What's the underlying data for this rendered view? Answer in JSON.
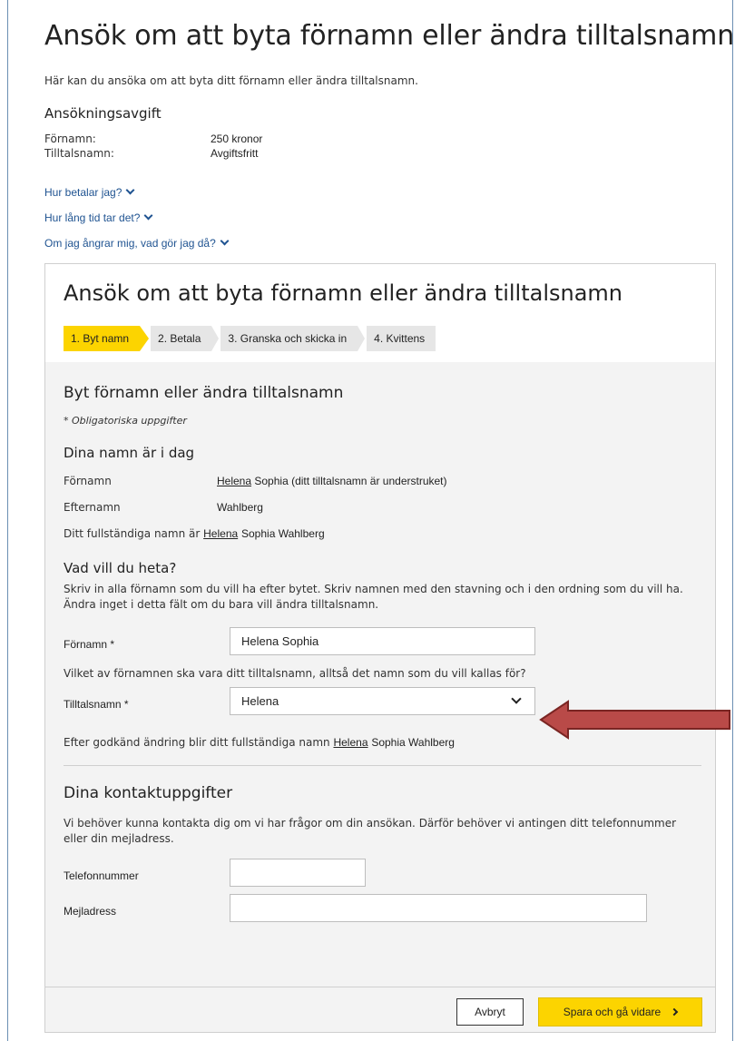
{
  "page": {
    "title": "Ansök om att byta förnamn eller ändra tilltalsnamn",
    "intro": "Här kan du ansöka om att byta ditt förnamn eller ändra tilltalsnamn.",
    "fee_heading": "Ansökningsavgift",
    "fees": [
      {
        "label": "Förnamn:",
        "value": "250 kronor"
      },
      {
        "label": "Tilltalsnamn:",
        "value": "Avgiftsfritt"
      }
    ],
    "accordions": [
      "Hur betalar jag?",
      "Hur lång tid tar det?",
      "Om jag ångrar mig, vad gör jag då?"
    ]
  },
  "form": {
    "title": "Ansök om att byta förnamn eller ändra tilltalsnamn",
    "steps": [
      "1. Byt namn",
      "2. Betala",
      "3. Granska och skicka in",
      "4. Kvittens"
    ],
    "section_title": "Byt förnamn eller ändra tilltalsnamn",
    "required_note": "* Obligatoriska uppgifter",
    "current": {
      "heading": "Dina namn är i dag",
      "first_label": "Förnamn",
      "first_call": "Helena",
      "first_rest": "Sophia",
      "first_note": "(ditt tilltalsnamn är understruket)",
      "last_label": "Efternamn",
      "last_value": "Wahlberg",
      "full_prefix": "Ditt fullständiga namn är",
      "full_call": "Helena",
      "full_rest": "Sophia Wahlberg"
    },
    "wanted": {
      "heading": "Vad vill du heta?",
      "instructions": "Skriv in alla förnamn som du vill ha efter bytet. Skriv namnen med den stavning och i den ordning som du vill ha. Ändra inget i detta fält om du bara vill ändra tilltalsnamn.",
      "first_label": "Förnamn *",
      "first_value": "Helena Sophia",
      "call_question": "Vilket av förnamnen ska vara ditt tilltalsnamn, alltså det namn som du vill kallas för?",
      "call_label": "Tilltalsnamn *",
      "call_value": "Helena",
      "after_prefix": "Efter godkänd ändring blir ditt fullständiga namn",
      "after_call": "Helena",
      "after_rest": "Sophia Wahlberg"
    },
    "contact": {
      "heading": "Dina kontaktuppgifter",
      "instructions": "Vi behöver kunna kontakta dig om vi har frågor om din ansökan. Därför behöver vi antingen ditt telefonnummer eller din mejladress.",
      "phone_label": "Telefonnummer",
      "phone_value": "",
      "email_label": "Mejladress",
      "email_value": ""
    },
    "buttons": {
      "cancel": "Avbryt",
      "next": "Spara och gå vidare"
    }
  },
  "colors": {
    "accent_yellow": "#fcd400",
    "link_blue": "#1f5391",
    "annotation_arrow": "#b94a48"
  }
}
